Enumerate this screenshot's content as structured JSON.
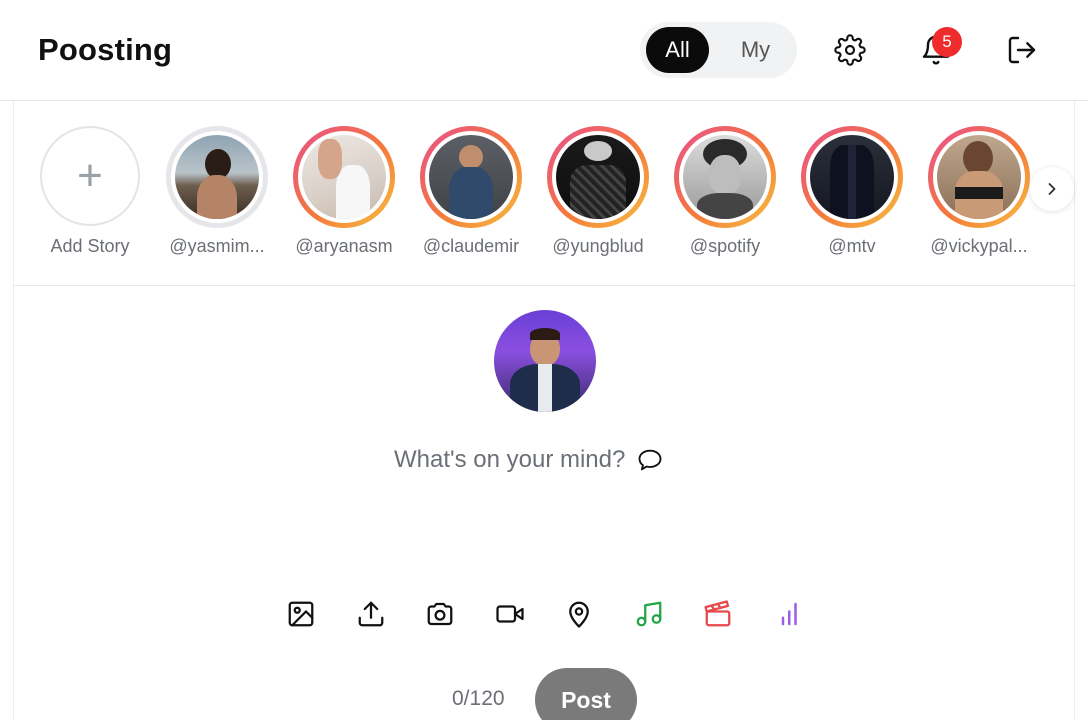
{
  "header": {
    "brand": "Poosting",
    "toggle": {
      "all": "All",
      "my": "My",
      "selected": "All"
    },
    "icons": {
      "settings": "gear-icon",
      "notifications": "bell-icon",
      "logout": "logout-icon"
    },
    "notification_count": "5"
  },
  "stories": {
    "add_label": "Add Story",
    "add_symbol": "+",
    "items": [
      {
        "name": "@yasmim...",
        "seen": true
      },
      {
        "name": "@aryanasm",
        "seen": false
      },
      {
        "name": "@claudemir",
        "seen": false
      },
      {
        "name": "@yungblud",
        "seen": false
      },
      {
        "name": "@spotify",
        "seen": false
      },
      {
        "name": "@mtv",
        "seen": false
      },
      {
        "name": "@vickypal...",
        "seen": false
      }
    ],
    "next_icon": "chevron-right-icon"
  },
  "composer": {
    "placeholder": "What's on your mind?",
    "placeholder_icon": "speech-bubble-icon",
    "tools": [
      {
        "name": "image-icon",
        "color": "#111111"
      },
      {
        "name": "upload-icon",
        "color": "#111111"
      },
      {
        "name": "camera-icon",
        "color": "#111111"
      },
      {
        "name": "video-icon",
        "color": "#111111"
      },
      {
        "name": "location-pin-icon",
        "color": "#111111"
      },
      {
        "name": "music-icon",
        "color": "#22a546"
      },
      {
        "name": "clapperboard-icon",
        "color": "#e5484d"
      },
      {
        "name": "poll-icon",
        "color": "#9b5de5"
      }
    ],
    "counter": "0/120",
    "post_label": "Post"
  },
  "colors": {
    "story_ring_gradient": [
      "#e94e8e",
      "#f47a3b",
      "#f7c240"
    ],
    "badge": "#ef2b2b",
    "post_button": "#7a7a7a"
  }
}
